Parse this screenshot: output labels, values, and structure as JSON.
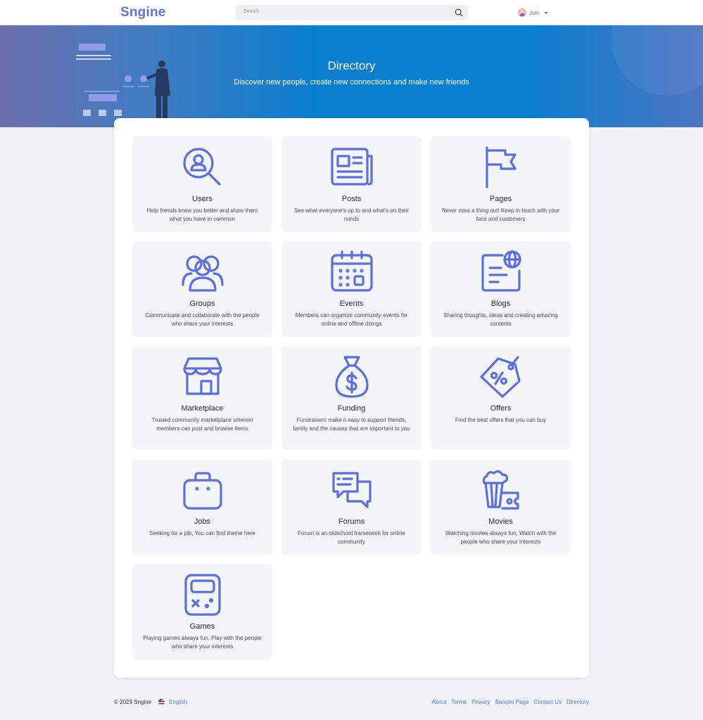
{
  "header": {
    "logo": "Sngine",
    "search_placeholder": "Search",
    "join_label": "Join"
  },
  "hero": {
    "title": "Directory",
    "subtitle": "Discover new people, create new connections and make new friends"
  },
  "tiles": [
    {
      "title": "Users",
      "desc": "Help friends know you better and show them what you have in common",
      "icon": "users-search-icon"
    },
    {
      "title": "Posts",
      "desc": "See what everyone's up to and what's on their minds",
      "icon": "newspaper-icon"
    },
    {
      "title": "Pages",
      "desc": "Never miss a thing out! Keep in touch with your fans and customers",
      "icon": "flag-icon"
    },
    {
      "title": "Groups",
      "desc": "Communicate and collaborate with the people who share your interests",
      "icon": "group-icon"
    },
    {
      "title": "Events",
      "desc": "Members can organize community events for online and offline doings",
      "icon": "calendar-icon"
    },
    {
      "title": "Blogs",
      "desc": "Sharing thoughts, ideas and creating amazing contents",
      "icon": "blog-globe-icon"
    },
    {
      "title": "Marketplace",
      "desc": "Trusted community marketplace wherein members can post and browse items",
      "icon": "store-icon"
    },
    {
      "title": "Funding",
      "desc": "Fundraisers make it easy to support friends, family and the causes that are important to you",
      "icon": "money-bag-icon"
    },
    {
      "title": "Offers",
      "desc": "Find the best offers that you can buy",
      "icon": "discount-tag-icon"
    },
    {
      "title": "Jobs",
      "desc": "Seeking for a job, You can find theme here",
      "icon": "briefcase-icon"
    },
    {
      "title": "Forums",
      "desc": "Forum is an oldschool framework for online community",
      "icon": "chat-bubbles-icon"
    },
    {
      "title": "Movies",
      "desc": "Watching movies always fun, Watch with the people who share your interests",
      "icon": "popcorn-ticket-icon"
    },
    {
      "title": "Games",
      "desc": "Playing games always fun, Play with the people who share your interests",
      "icon": "game-console-icon"
    }
  ],
  "footer": {
    "copyright": "© 2023 Sngine",
    "language": "English",
    "links": [
      "About",
      "Terms",
      "Privacy",
      "Sample Page",
      "Contact Us",
      "Directory"
    ]
  },
  "colors": {
    "brand": "#5e72e4",
    "icon_stroke": "#5b6ee1",
    "hero_blue": "#0a7fcf"
  }
}
